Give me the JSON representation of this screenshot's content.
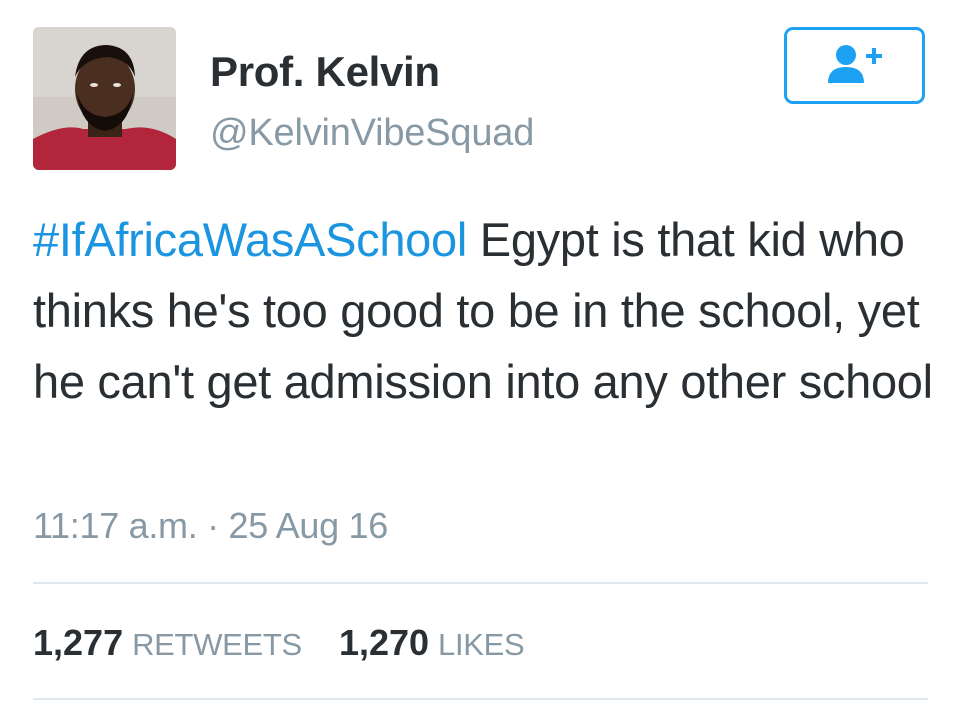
{
  "user": {
    "display_name": "Prof. Kelvin",
    "handle": "@KelvinVibeSquad",
    "avatar_icon": "profile-photo"
  },
  "follow_button": {
    "icon": "add-user-icon",
    "color": "#1da1f2"
  },
  "tweet": {
    "hashtag": "#IfAfricaWasASchool",
    "text": " Egypt is that kid who thinks he's too good to be in the school, yet he can't get admission into any other school",
    "timestamp": "11:17 a.m. · 25 Aug 16"
  },
  "stats": {
    "retweets_count": "1,277",
    "retweets_label": "RETWEETS",
    "likes_count": "1,270",
    "likes_label": "LIKES"
  },
  "colors": {
    "hashtag": "#1b95e0",
    "text": "#292f33",
    "muted": "#8899a6",
    "divider": "#e1e8ed"
  }
}
